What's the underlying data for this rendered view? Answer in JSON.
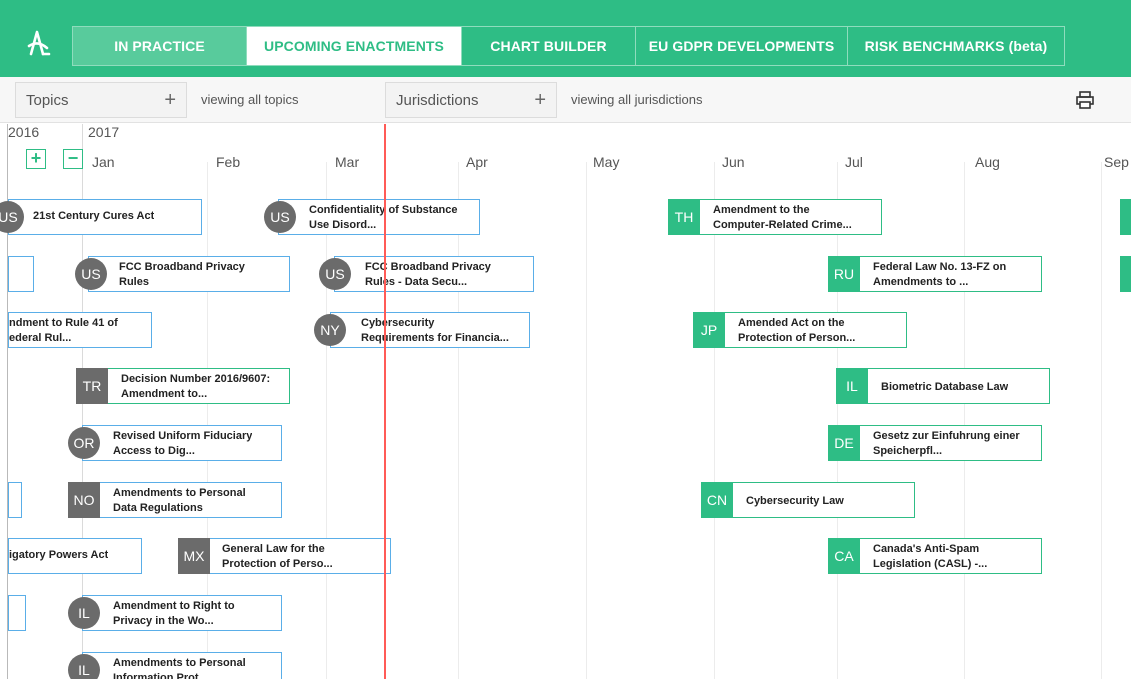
{
  "nav": {
    "tabs": [
      "IN PRACTICE",
      "UPCOMING ENACTMENTS",
      "CHART BUILDER",
      "EU GDPR DEVELOPMENTS",
      "RISK BENCHMARKS (beta)"
    ]
  },
  "filters": {
    "topics_label": "Topics",
    "topics_plus": "+",
    "topics_viewing": "viewing all topics",
    "jurisdictions_label": "Jurisdictions",
    "jurisdictions_plus": "+",
    "jurisdictions_viewing": "viewing all jurisdictions"
  },
  "timeline": {
    "years": [
      "2016",
      "2017"
    ],
    "months": [
      "Jan",
      "Feb",
      "Mar",
      "Apr",
      "May",
      "Jun",
      "Jul",
      "Aug",
      "Sep"
    ],
    "zoom_in": "+",
    "zoom_out": "−"
  },
  "events": [
    {
      "badge": "US",
      "title": "21st Century Cures Act"
    },
    {
      "badge": "US",
      "title": "Confidentiality of Substance\nUse Disord..."
    },
    {
      "badge": "",
      "title": ""
    },
    {
      "badge": "US",
      "title": "FCC Broadband Privacy\nRules"
    },
    {
      "badge": "US",
      "title": "FCC Broadband Privacy\nRules - Data Secu..."
    },
    {
      "badge": "",
      "title": "ndment to Rule 41 of\nederal Rul..."
    },
    {
      "badge": "NY",
      "title": "Cybersecurity\nRequirements for Financia..."
    },
    {
      "badge": "TR",
      "title": "Decision Number 2016/9607:\nAmendment to..."
    },
    {
      "badge": "OR",
      "title": "Revised Uniform Fiduciary\nAccess to Dig..."
    },
    {
      "badge": "",
      "title": ""
    },
    {
      "badge": "NO",
      "title": "Amendments to Personal\nData Regulations"
    },
    {
      "badge": "",
      "title": "igatory Powers Act"
    },
    {
      "badge": "MX",
      "title": "General Law for the\nProtection of Perso..."
    },
    {
      "badge": "",
      "title": ""
    },
    {
      "badge": "IL",
      "title": "Amendment to Right to\nPrivacy in the Wo..."
    },
    {
      "badge": "IL",
      "title": "Amendments to Personal\nInformation Prot..."
    },
    {
      "badge": "TH",
      "title": "Amendment to the\nComputer-Related Crime..."
    },
    {
      "badge": "RU",
      "title": "Federal Law No. 13-FZ on\nAmendments to ..."
    },
    {
      "badge": "JP",
      "title": "Amended Act on the\nProtection of Person..."
    },
    {
      "badge": "IL",
      "title": "Biometric Database Law"
    },
    {
      "badge": "DE",
      "title": "Gesetz zur Einfuhrung einer\nSpeicherpfl..."
    },
    {
      "badge": "CN",
      "title": "Cybersecurity Law"
    },
    {
      "badge": "CA",
      "title": "Canada's Anti-Spam\nLegislation (CASL) -..."
    }
  ],
  "colors": {
    "brand_green": "#2ebd85",
    "event_blue": "#5aaee8",
    "badge_gray": "#6b6b6b",
    "today_line": "#ff5b57"
  },
  "icons": {
    "logo": "logo-icon",
    "print": "print-icon"
  }
}
